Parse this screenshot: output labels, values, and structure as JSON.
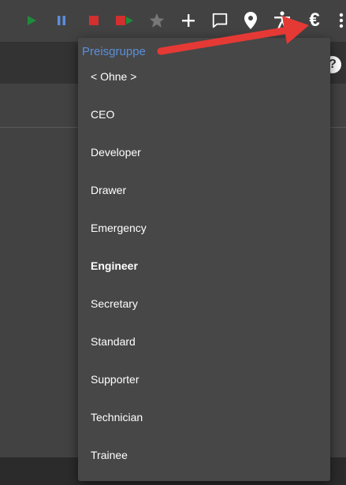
{
  "toolbar": {
    "buttons": [
      {
        "name": "play-icon",
        "color": "#1e8c3a"
      },
      {
        "name": "pause-icon",
        "color": "#5b8fd9"
      },
      {
        "name": "stop-icon",
        "color": "#d32f2f"
      },
      {
        "name": "stop-play-icon",
        "color": "#d32f2f"
      },
      {
        "name": "star-icon",
        "color": "#777777"
      },
      {
        "name": "plus-icon",
        "color": "#ffffff"
      },
      {
        "name": "comment-icon",
        "color": "#ffffff"
      },
      {
        "name": "map-marker-icon",
        "color": "#ffffff"
      },
      {
        "name": "accessibility-icon",
        "color": "#ffffff"
      },
      {
        "name": "euro-icon",
        "color": "#ffffff"
      },
      {
        "name": "more-icon",
        "color": "#ffffff"
      }
    ],
    "euro_symbol": "€"
  },
  "header": {
    "help_symbol": "?"
  },
  "price_group_menu": {
    "header": "Preisgruppe",
    "items": [
      {
        "label": "< Ohne >",
        "bold": false
      },
      {
        "label": "CEO",
        "bold": false
      },
      {
        "label": "Developer",
        "bold": false
      },
      {
        "label": "Drawer",
        "bold": false
      },
      {
        "label": "Emergency",
        "bold": false
      },
      {
        "label": "Engineer",
        "bold": true
      },
      {
        "label": "Secretary",
        "bold": false
      },
      {
        "label": "Standard",
        "bold": false
      },
      {
        "label": "Supporter",
        "bold": false
      },
      {
        "label": "Technician",
        "bold": false
      },
      {
        "label": "Trainee",
        "bold": false
      }
    ]
  },
  "colors": {
    "background": "#424242",
    "menu_background": "#474747",
    "accent_blue": "#5b8fd9",
    "annotation_red": "#e53935"
  }
}
